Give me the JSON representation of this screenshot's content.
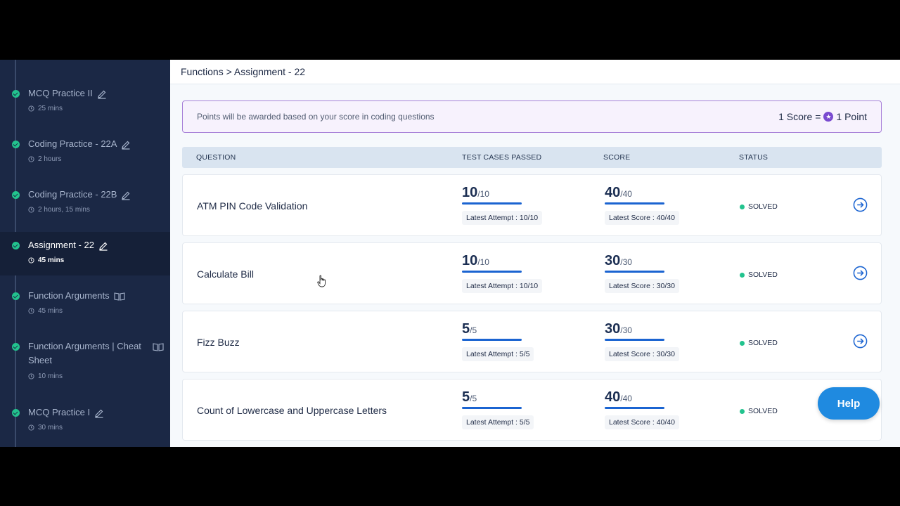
{
  "breadcrumb": "Functions > Assignment - 22",
  "points_banner": {
    "text": "Points will be awarded based on your score in coding questions",
    "left_value": "1 Score =",
    "right_value": "1 Point",
    "coin_icon": "star-coin-icon"
  },
  "sidebar": {
    "items": [
      {
        "title": "MCQ Practice II",
        "time": "25 mins",
        "icon": "edit-icon"
      },
      {
        "title": "Coding Practice - 22A",
        "time": "2 hours",
        "icon": "edit-icon"
      },
      {
        "title": "Coding Practice - 22B",
        "time": "2 hours, 15 mins",
        "icon": "edit-icon"
      },
      {
        "title": "Assignment - 22",
        "time": "45 mins",
        "icon": "edit-icon",
        "active": true
      },
      {
        "title": "Function Arguments",
        "time": "45 mins",
        "icon": "book-icon"
      },
      {
        "title": "Function Arguments | Cheat Sheet",
        "time": "10 mins",
        "icon": "book-icon"
      },
      {
        "title": "MCQ Practice I",
        "time": "30 mins",
        "icon": "edit-icon"
      }
    ]
  },
  "table": {
    "headers": {
      "question": "QUESTION",
      "test_cases": "TEST CASES PASSED",
      "score": "SCORE",
      "status": "STATUS"
    },
    "rows": [
      {
        "name": "ATM PIN Code Validation",
        "tc": "10",
        "tc_total": "/10",
        "tc_attempt": "Latest Attempt : 10/10",
        "tc_progress": 1.0,
        "score": "40",
        "score_total": "/40",
        "score_latest": "Latest Score : 40/40",
        "score_progress": 1.0,
        "status": "SOLVED"
      },
      {
        "name": "Calculate Bill",
        "tc": "10",
        "tc_total": "/10",
        "tc_attempt": "Latest Attempt : 10/10",
        "tc_progress": 1.0,
        "score": "30",
        "score_total": "/30",
        "score_latest": "Latest Score : 30/30",
        "score_progress": 1.0,
        "status": "SOLVED"
      },
      {
        "name": "Fizz Buzz",
        "tc": "5",
        "tc_total": "/5",
        "tc_attempt": "Latest Attempt : 5/5",
        "tc_progress": 1.0,
        "score": "30",
        "score_total": "/30",
        "score_latest": "Latest Score : 30/30",
        "score_progress": 1.0,
        "status": "SOLVED"
      },
      {
        "name": "Count of Lowercase and Uppercase Letters",
        "tc": "5",
        "tc_total": "/5",
        "tc_attempt": "Latest Attempt : 5/5",
        "tc_progress": 1.0,
        "score": "40",
        "score_total": "/40",
        "score_latest": "Latest Score : 40/40",
        "score_progress": 1.0,
        "status": "SOLVED"
      }
    ]
  },
  "help_button": "Help",
  "colors": {
    "sidebar_bg": "#1b2845",
    "accent_blue": "#1b64d1",
    "solved_green": "#22c38e",
    "banner_border": "#a77fd8"
  }
}
